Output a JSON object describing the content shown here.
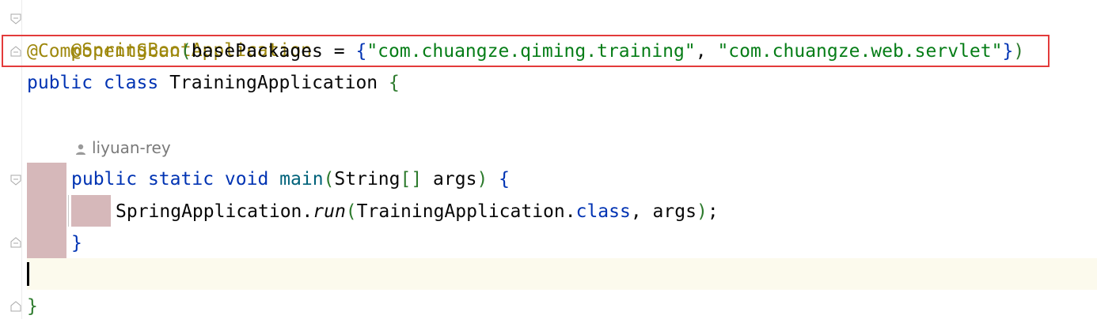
{
  "editor": {
    "lines": {
      "l1": {
        "annotation": "@SpringBootApplication"
      },
      "l2": {
        "annotation": "@ComponentScan",
        "open_paren": "(",
        "param": "basePackages",
        "equals": " = ",
        "open_brace": "{",
        "str1": "\"com.chuangze.qiming.training\"",
        "comma": ", ",
        "str2": "\"com.chuangze.web.servlet\"",
        "close_brace": "}",
        "close_paren": ")"
      },
      "l3": {
        "kw_public": "public",
        "kw_class": "class",
        "class_name": "TrainingApplication",
        "open_brace": "{"
      },
      "l5": {
        "kw_public": "public",
        "kw_static": "static",
        "kw_void": "void",
        "method": "main",
        "open_paren": "(",
        "param_type": "String",
        "array": "[]",
        "param_name": " args",
        "close_paren": ")",
        "open_brace": "{"
      },
      "l6": {
        "target": "SpringApplication.",
        "method": "run",
        "open_paren": "(",
        "arg1": "TrainingApplication.",
        "kw_class": "class",
        "rest": ", args",
        "close_paren": ")",
        "semicolon": ";"
      },
      "l7": {
        "close_brace": "}"
      },
      "l9": {
        "close_brace": "}"
      }
    },
    "author_hint": "liyuan-rey",
    "icons": {
      "author": "person-icon",
      "fold": "fold-marker-icon"
    },
    "colors": {
      "annotation": "#9e880d",
      "keyword": "#0033b3",
      "string": "#067d17",
      "method": "#00627a",
      "highlight_border": "#e33b3b",
      "caret_line": "#fcfaed"
    }
  }
}
